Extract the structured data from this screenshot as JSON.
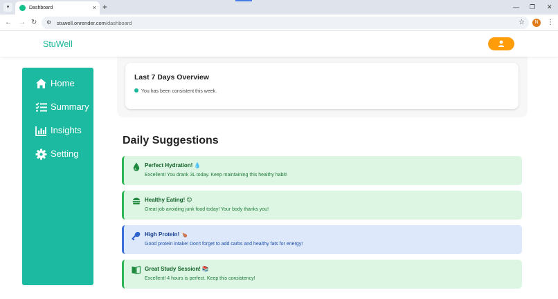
{
  "browser": {
    "tab_title": "Dashboard",
    "tab_close": "×",
    "new_tab": "+",
    "url_domain": "stuwell.onrender.com",
    "url_path": "/dashboard",
    "profile_initial": "N",
    "minimize": "—",
    "restore": "❐",
    "close": "✕"
  },
  "header": {
    "brand": "StuWell",
    "accent_color": "#1bb79a",
    "user_button_color": "#ff9c0a"
  },
  "sidebar": {
    "color": "#1cbaa0",
    "items": [
      {
        "label": "Home",
        "icon": "home-icon"
      },
      {
        "label": "Summary",
        "icon": "list-check-icon"
      },
      {
        "label": "Insights",
        "icon": "bar-chart-icon"
      },
      {
        "label": "Setting",
        "icon": "gear-icon"
      }
    ]
  },
  "overview": {
    "title": "Last 7 Days Overview",
    "status_text": "You has been consistent this week."
  },
  "suggestions": {
    "title": "Daily Suggestions",
    "cards": [
      {
        "title": "Perfect Hydration!",
        "emoji": "💧",
        "description": "Excellent! You drank 3L today. Keep maintaining this healthy habit!",
        "style": "green",
        "icon": "water-drop-icon"
      },
      {
        "title": "Healthy Eating!",
        "emoji": "😊",
        "description": "Great job avoiding junk food today! Your body thanks you!",
        "style": "green",
        "icon": "burger-icon"
      },
      {
        "title": "High Protein!",
        "emoji": "🍗",
        "description": "Good protein intake! Don't forget to add carbs and healthy fats for energy!",
        "style": "blue",
        "icon": "drumstick-icon"
      },
      {
        "title": "Great Study Session!",
        "emoji": "📚",
        "description": "Excellent! 4 hours is perfect. Keep this consistency!",
        "style": "green",
        "icon": "book-icon"
      }
    ]
  }
}
